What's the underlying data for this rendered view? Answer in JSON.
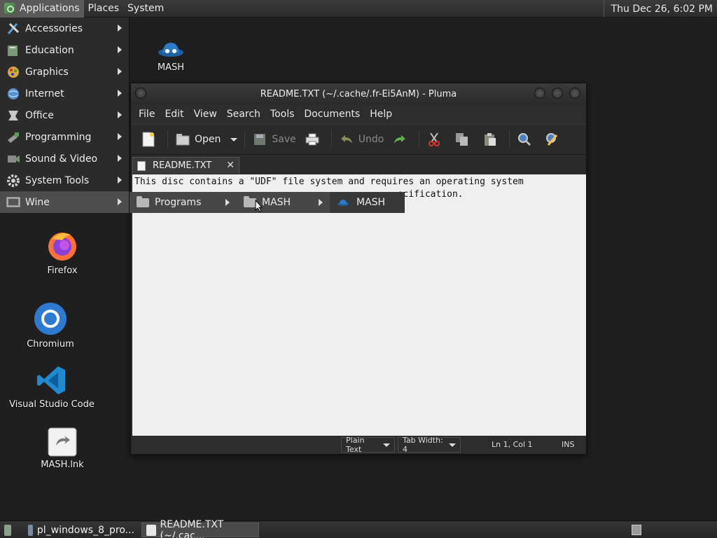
{
  "top_panel": {
    "menus": [
      "Applications",
      "Places",
      "System"
    ],
    "clock": "Thu Dec 26,  6:02 PM"
  },
  "apps_menu": {
    "items": [
      {
        "label": "Accessories",
        "icon": "accessories-icon"
      },
      {
        "label": "Education",
        "icon": "education-icon"
      },
      {
        "label": "Graphics",
        "icon": "graphics-icon"
      },
      {
        "label": "Internet",
        "icon": "internet-globe-icon"
      },
      {
        "label": "Office",
        "icon": "office-icon"
      },
      {
        "label": "Programming",
        "icon": "programming-icon"
      },
      {
        "label": "Sound & Video",
        "icon": "sound-video-icon"
      },
      {
        "label": "System Tools",
        "icon": "system-tools-gear-icon"
      },
      {
        "label": "Wine",
        "icon": "wine-icon"
      }
    ]
  },
  "submenus": {
    "programs": "Programs",
    "mash_folder": "MASH",
    "mash_app": "MASH"
  },
  "desktop_icons": [
    {
      "label": "MASH",
      "icon": "mash-icon"
    },
    {
      "label": "Firefox",
      "icon": "firefox-icon"
    },
    {
      "label": "Chromium",
      "icon": "chromium-icon"
    },
    {
      "label": "Visual Studio Code",
      "icon": "vscode-icon"
    },
    {
      "label": "MASH.lnk",
      "icon": "shortcut-file-icon"
    }
  ],
  "window": {
    "title": "README.TXT (~/.cache/.fr-Ei5AnM) - Pluma",
    "menu": [
      "File",
      "Edit",
      "View",
      "Search",
      "Tools",
      "Documents",
      "Help"
    ],
    "toolbar": {
      "open": "Open",
      "save": "Save",
      "undo": "Undo"
    },
    "tab_label": "README.TXT",
    "tab_close": "✕",
    "text_line1": "This disc contains a \"UDF\" file system and requires an operating system",
    "text_line2": "                                                ecification.",
    "status": {
      "syntax": "Plain Text",
      "tab_width": "Tab Width:  4",
      "position": "Ln 1, Col 1",
      "mode": "INS"
    }
  },
  "taskbar": {
    "items": [
      "pl_windows_8_pro...",
      "README.TXT (~/.cac..."
    ]
  }
}
